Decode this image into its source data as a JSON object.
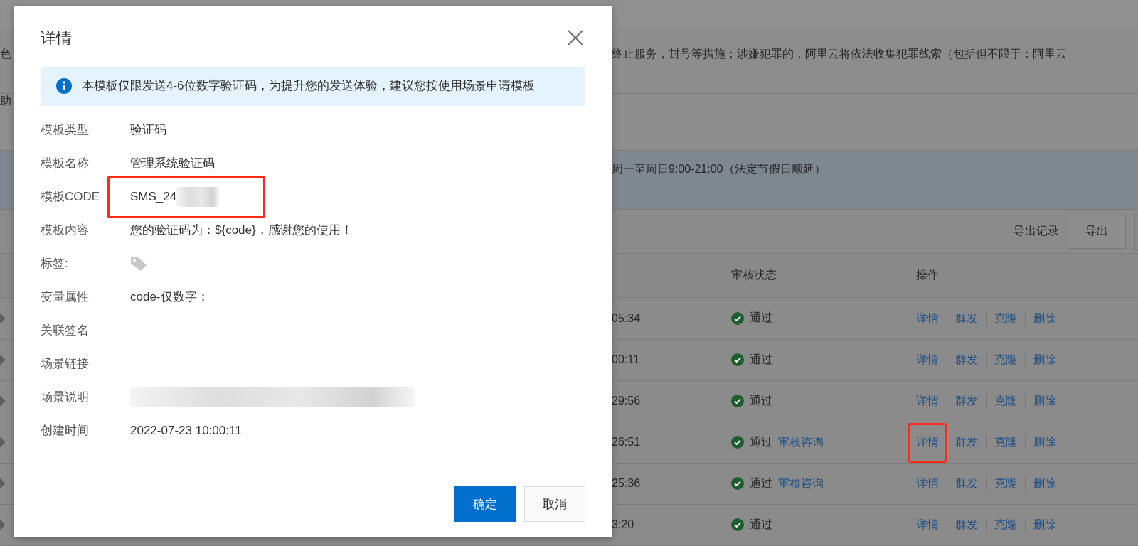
{
  "background_page": {
    "notice_fragment": "色",
    "notice": "终止服务，封号等措施；涉嫌犯罪的，阿里云将依法收集犯罪线索（包括但不限于：阿里云",
    "tab_fragment": "助",
    "hours": "周一至周日9:00-21:00（法定节假日顺延）",
    "toolbar": {
      "records_link": "导出记录",
      "export_button": "导出"
    },
    "table": {
      "columns": [
        "审核状态",
        "操作"
      ],
      "rows": [
        {
          "time": "05:34",
          "status": "通过",
          "actions": [
            "详情",
            "群发",
            "克隆",
            "删除"
          ],
          "highlighted": false
        },
        {
          "time": "00:11",
          "status": "通过",
          "actions": [
            "详情",
            "群发",
            "克隆",
            "删除"
          ],
          "highlighted": false
        },
        {
          "time": "29:56",
          "status": "通过",
          "actions": [
            "详情",
            "群发",
            "克隆",
            "删除"
          ],
          "highlighted": false
        },
        {
          "time": "26:51",
          "status": "通过",
          "consult_link": "审核咨询",
          "actions": [
            "详情",
            "群发",
            "克隆",
            "删除"
          ],
          "highlighted": true
        },
        {
          "time": "25:36",
          "status": "通过",
          "consult_link": "审核咨询",
          "actions": [
            "详情",
            "群发",
            "克隆",
            "删除"
          ],
          "highlighted": false
        },
        {
          "time": "3:20",
          "status": "通过",
          "actions": [
            "详情",
            "群发",
            "克隆",
            "删除"
          ],
          "highlighted": false
        }
      ]
    }
  },
  "dialog": {
    "title": "详情",
    "alert": "本模板仅限发送4-6位数字验证码，为提升您的发送体验，建议您按使用场景申请模板",
    "fields": [
      {
        "label": "模板类型",
        "kind": "text",
        "value": "验证码"
      },
      {
        "label": "模板名称",
        "kind": "text",
        "value": "管理系统验证码"
      },
      {
        "label": "模板CODE",
        "kind": "code",
        "value": "SMS_24",
        "highlighted": true
      },
      {
        "label": "模板内容",
        "kind": "text",
        "value": "您的验证码为：${code}，感谢您的使用！"
      },
      {
        "label": "标签:",
        "kind": "tag"
      },
      {
        "label": "变量属性",
        "kind": "text",
        "value": "code-仅数字；"
      },
      {
        "label": "关联签名",
        "kind": "empty"
      },
      {
        "label": "场景链接",
        "kind": "empty"
      },
      {
        "label": "场景说明",
        "kind": "redacted"
      },
      {
        "label": "创建时间",
        "kind": "text",
        "value": "2022-07-23 10:00:11"
      }
    ],
    "buttons": [
      {
        "label": "确定",
        "primary": true
      },
      {
        "label": "取消",
        "primary": false
      }
    ]
  }
}
